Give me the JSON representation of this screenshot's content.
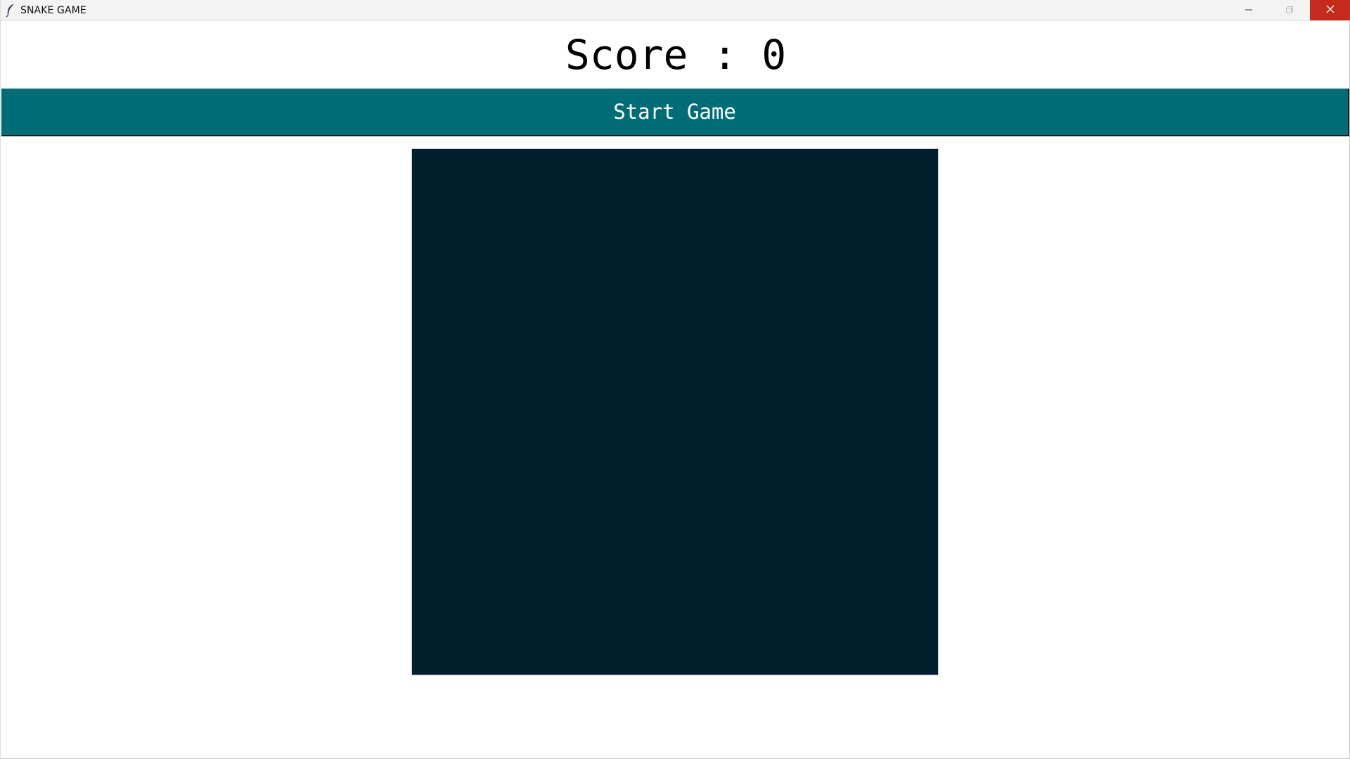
{
  "window": {
    "title": "SNAKE GAME",
    "icon": "feather-icon",
    "controls": {
      "minimize_icon": "minimize-icon",
      "maximize_icon": "maximize-icon",
      "close_icon": "close-icon"
    }
  },
  "score": {
    "text": "Score : 0",
    "value": 0
  },
  "start_button": {
    "label": "Start Game"
  },
  "colors": {
    "button_bg": "#006c76",
    "board_bg": "#001f2d",
    "close_button": "#c42b1c"
  }
}
